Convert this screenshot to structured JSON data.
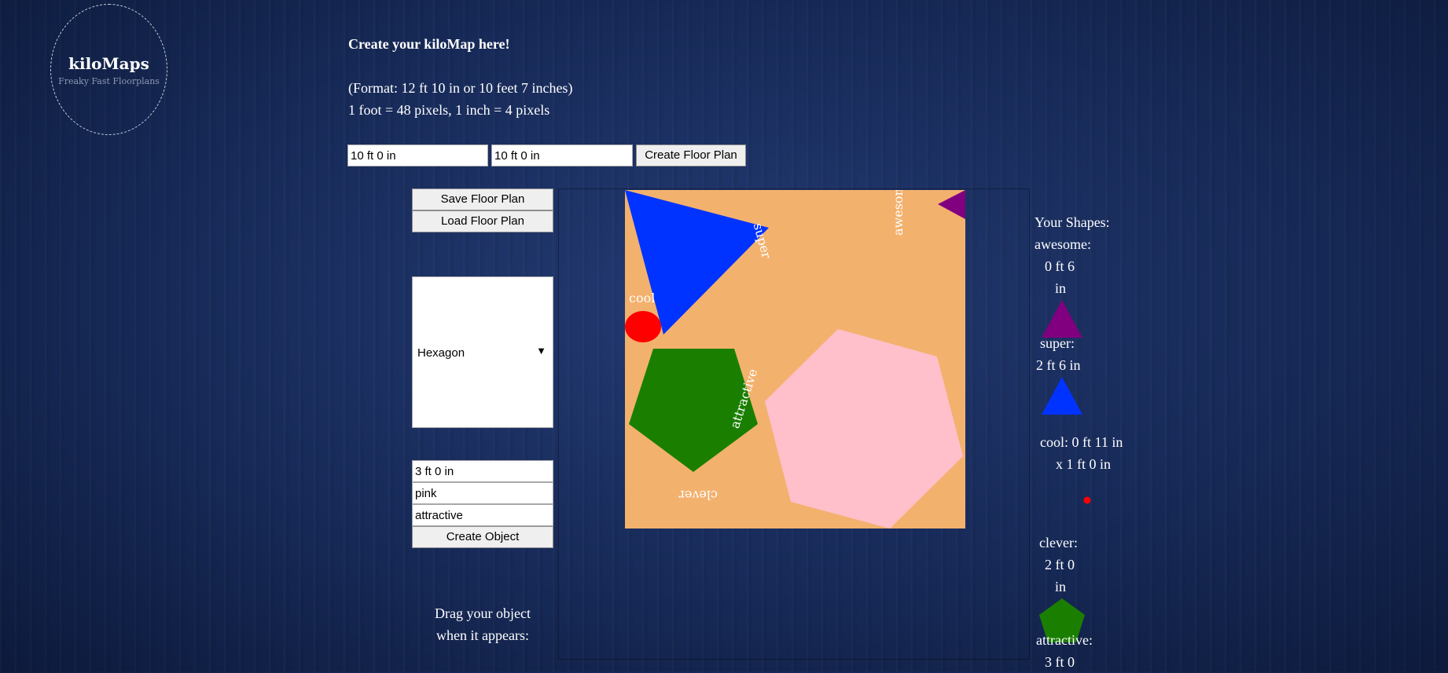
{
  "logo": {
    "title": "kiloMaps",
    "tagline": "Freaky Fast Floorplans"
  },
  "instructions": {
    "heading": "Create your kiloMap here!",
    "format": "(Format: 12 ft 10 in or 10 feet 7 inches)",
    "scale": "1 foot = 48 pixels, 1 inch = 4 pixels"
  },
  "floor_plan_form": {
    "width_value": "10 ft 0 in",
    "height_value": "10 ft 0 in",
    "create_label": "Create Floor Plan"
  },
  "actions": {
    "save_label": "Save Floor Plan",
    "load_label": "Load Floor Plan"
  },
  "object_form": {
    "shape_selected": "Hexagon",
    "size_value": "3 ft 0 in",
    "color_value": "pink",
    "name_value": "attractive",
    "create_label": "Create Object"
  },
  "drag_instruction": "Drag your object when it appears:",
  "floor": {
    "background": "#f3b16e",
    "shapes": [
      {
        "name": "super",
        "type": "triangle",
        "color": "#0033ff"
      },
      {
        "name": "awesome",
        "type": "triangle",
        "color": "#800080"
      },
      {
        "name": "cool",
        "type": "ellipse",
        "color": "#ff0000"
      },
      {
        "name": "clever",
        "type": "pentagon",
        "color": "#1a7f00"
      },
      {
        "name": "attractive",
        "type": "hexagon",
        "color": "#ffc0cb"
      }
    ]
  },
  "your_shapes": {
    "heading": "Your Shapes:",
    "awesome": {
      "label": "awesome:",
      "size_line1": "0 ft 6",
      "size_line2": "in",
      "color": "#800080"
    },
    "super": {
      "label": "super:",
      "size_line1": "2 ft 6 in",
      "color": "#0033ff"
    },
    "cool": {
      "label": "cool: 0 ft 11 in",
      "size_line2": "x 1 ft 0 in",
      "color": "#ff0000"
    },
    "clever": {
      "label": "clever:",
      "size_line1": "2 ft 0",
      "size_line2": "in",
      "color": "#1a7f00"
    },
    "attractive": {
      "label": "attractive:",
      "size_line1": "3 ft 0"
    }
  }
}
